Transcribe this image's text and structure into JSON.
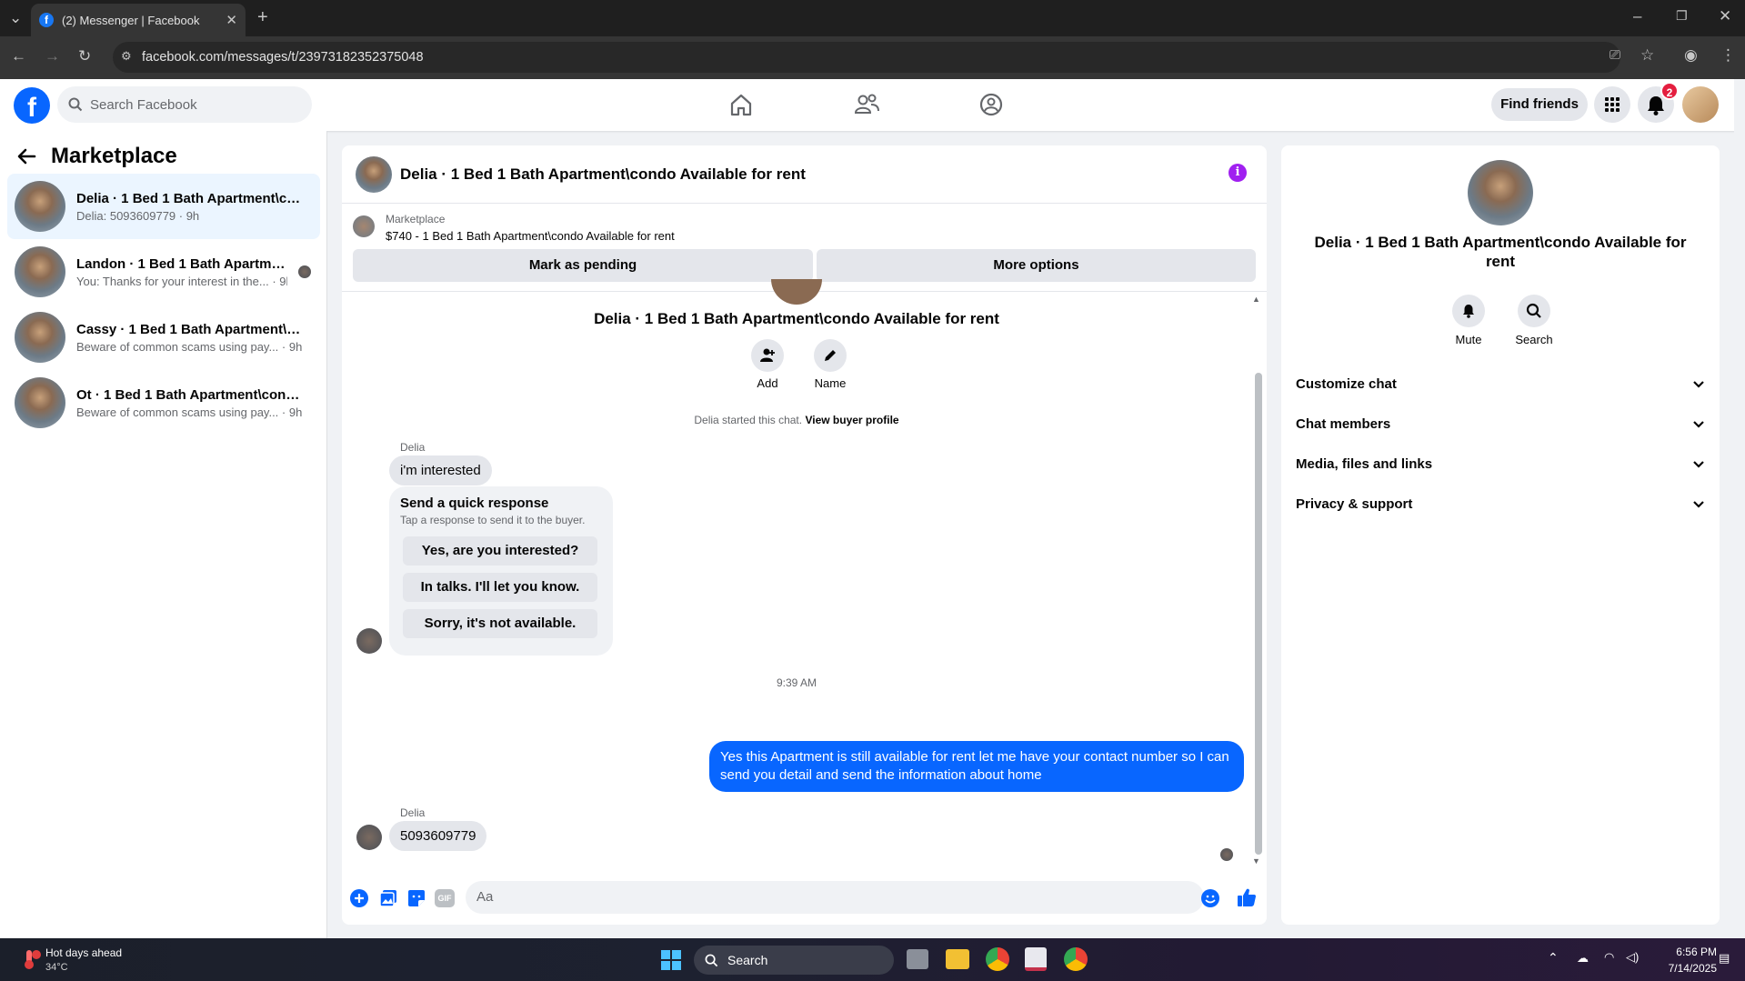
{
  "browser": {
    "tab_title": "(2) Messenger | Facebook",
    "url": "facebook.com/messages/t/23973182352375048"
  },
  "header": {
    "search_placeholder": "Search Facebook",
    "find_friends": "Find friends",
    "notification_count": "2"
  },
  "sidebar": {
    "title": "Marketplace",
    "conversations": [
      {
        "name": "Delia · 1 Bed 1 Bath Apartment\\co...",
        "preview": "Delia: 5093609779 · 9h",
        "active": true
      },
      {
        "name": "Landon · 1 Bed 1 Bath Apartmen...",
        "preview": "You: Thanks for your interest in the... · 9h",
        "active": false
      },
      {
        "name": "Cassy · 1 Bed 1 Bath Apartment\\co...",
        "preview": "Beware of common scams using pay... · 9h",
        "active": false
      },
      {
        "name": "Ot · 1 Bed 1 Bath Apartment\\cond...",
        "preview": "Beware of common scams using pay... · 9h",
        "active": false
      }
    ]
  },
  "chat": {
    "title": "Delia · 1 Bed 1 Bath Apartment\\condo Available for rent",
    "marketplace_label": "Marketplace",
    "listing": "$740 - 1 Bed 1 Bath Apartment\\condo Available for rent",
    "mark_pending": "Mark as pending",
    "more_options": "More options",
    "intro_title": "Delia · 1 Bed 1 Bath Apartment\\condo Available for rent",
    "add_label": "Add",
    "name_label": "Name",
    "started_text": "Delia started this chat.",
    "view_buyer_profile": "View buyer profile",
    "sender1": "Delia",
    "msg1": "i'm interested",
    "quick_title": "Send a quick response",
    "quick_sub": "Tap a response to send it to the buyer.",
    "quick_responses": [
      "Yes, are you interested?",
      "In talks. I'll let you know.",
      "Sorry, it's not available."
    ],
    "timestamp": "9:39 AM",
    "outgoing": "Yes this Apartment is still available for rent let me have your contact number so I can send you detail and send the information about home",
    "sender2": "Delia",
    "msg2": "5093609779",
    "input_placeholder": "Aa"
  },
  "right_panel": {
    "name": "Delia · 1 Bed 1 Bath Apartment\\condo Available for rent",
    "mute": "Mute",
    "search": "Search",
    "sections": [
      "Customize chat",
      "Chat members",
      "Media, files and links",
      "Privacy & support"
    ]
  },
  "taskbar": {
    "weather_title": "Hot days ahead",
    "weather_temp": "34°C",
    "search": "Search",
    "time": "6:56 PM",
    "date": "7/14/2025"
  }
}
